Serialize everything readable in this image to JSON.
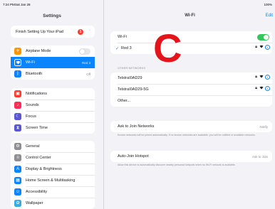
{
  "status": {
    "time": "7:24 PM",
    "date": "Sat Jan 28",
    "battery": "100%"
  },
  "settings": {
    "title": "Settings",
    "promo": {
      "label": "Finish Setting Up Your iPad",
      "badge": "1"
    },
    "group1": [
      {
        "label": "Airplane Mode",
        "icon": "airplane-icon",
        "color": "#ff9500",
        "value": ""
      },
      {
        "label": "Wi-Fi",
        "icon": "wifi-icon",
        "color": "#0a84ff",
        "value": "Red 3"
      },
      {
        "label": "Bluetooth",
        "icon": "bluetooth-icon",
        "color": "#0a84ff",
        "value": "Off"
      }
    ],
    "group2": [
      {
        "label": "Notifications",
        "icon": "notifications-icon",
        "color": "#ff3b30"
      },
      {
        "label": "Sounds",
        "icon": "sounds-icon",
        "color": "#ff2d55"
      },
      {
        "label": "Focus",
        "icon": "focus-icon",
        "color": "#5856d6"
      },
      {
        "label": "Screen Time",
        "icon": "screen-time-icon",
        "color": "#5856d6"
      }
    ],
    "group3": [
      {
        "label": "General",
        "icon": "gear-icon",
        "color": "#8e8e93"
      },
      {
        "label": "Control Center",
        "icon": "control-center-icon",
        "color": "#8e8e93"
      },
      {
        "label": "Display & Brightness",
        "icon": "display-icon",
        "color": "#0a84ff"
      },
      {
        "label": "Home Screen & Multitasking",
        "icon": "home-screen-icon",
        "color": "#0a84ff"
      },
      {
        "label": "Accessibility",
        "icon": "accessibility-icon",
        "color": "#0a84ff"
      },
      {
        "label": "Wallpaper",
        "icon": "wallpaper-icon",
        "color": "#32ade6"
      }
    ]
  },
  "wifi": {
    "title": "Wi-Fi",
    "edit": "Edit",
    "toggle_label": "Wi-Fi",
    "connected": "Red 3",
    "other_networks_header": "OTHER NETWORKS",
    "networks": [
      "TelstraI0AD29",
      "TelstraI0AD29-5G"
    ],
    "other": "Other...",
    "ask_join": {
      "label": "Ask to Join Networks",
      "value": "Notify"
    },
    "ask_join_footer": "Known networks will be joined automatically. If no known networks are available, you will be notified of available networks.",
    "auto_join": {
      "label": "Auto-Join Hotspot",
      "value": "Ask to Join"
    },
    "auto_join_footer": "Allow this device to automatically discover nearby personal hotspots when no Wi-Fi network is available."
  },
  "overlay_letter": "C",
  "accent": "#0a84ff",
  "toggle_on_color": "#34c759"
}
